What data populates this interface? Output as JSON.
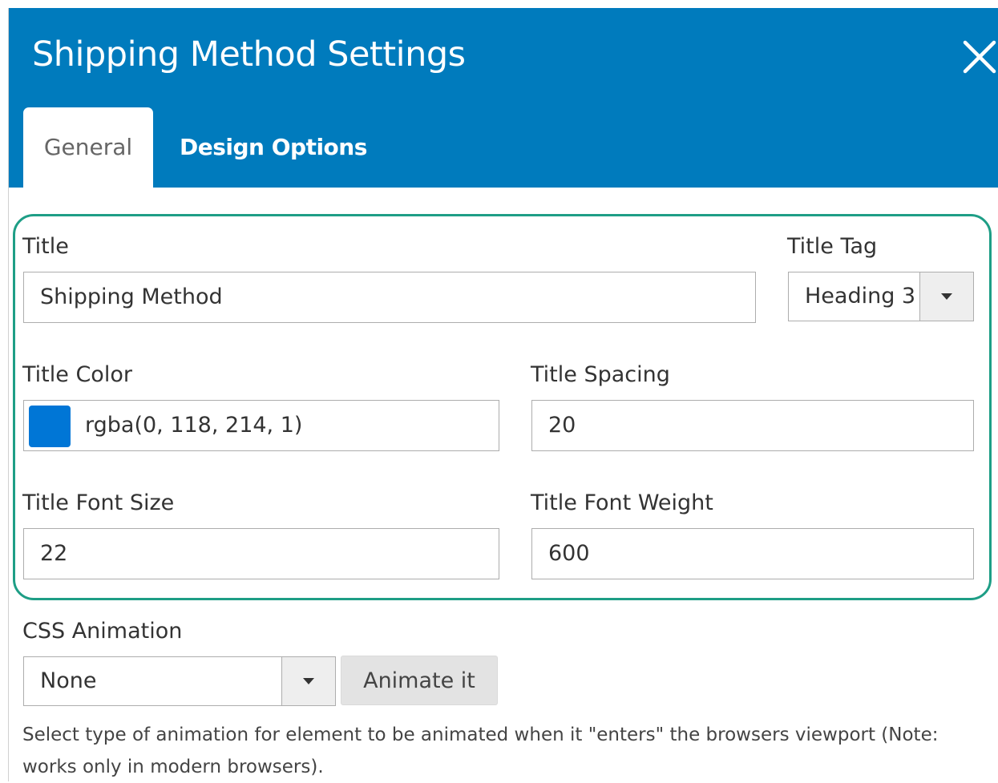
{
  "dialog": {
    "title": "Shipping Method Settings",
    "close_icon": "close-icon"
  },
  "tabs": [
    {
      "label": "General",
      "active": true
    },
    {
      "label": "Design Options",
      "active": false
    }
  ],
  "form": {
    "title_label": "Title",
    "title_value": "Shipping Method",
    "title_tag_label": "Title Tag",
    "title_tag_value": "Heading 3",
    "title_color_label": "Title Color",
    "title_color_value": "rgba(0, 118, 214, 1)",
    "title_color_swatch": "#0076d6",
    "title_spacing_label": "Title Spacing",
    "title_spacing_value": "20",
    "title_font_size_label": "Title Font Size",
    "title_font_size_value": "22",
    "title_font_weight_label": "Title Font Weight",
    "title_font_weight_value": "600",
    "css_animation_label": "CSS Animation",
    "css_animation_value": "None",
    "animate_button_label": "Animate it",
    "css_animation_help": "Select type of animation for element to be animated when it \"enters\" the browsers viewport (Note: works only in modern browsers)."
  },
  "colors": {
    "header_bg": "#007bbd",
    "highlight_border": "#1e9e86"
  }
}
